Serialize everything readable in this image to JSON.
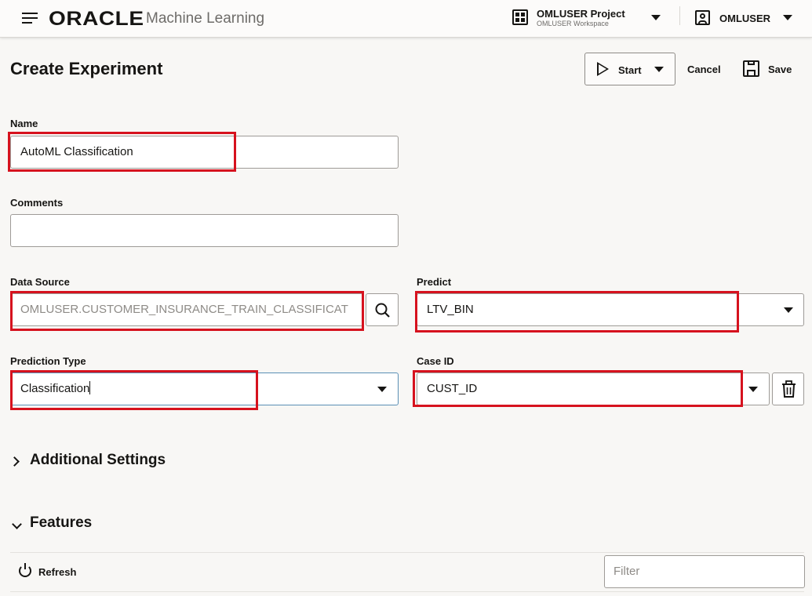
{
  "header": {
    "brand": "ORACLE",
    "app_name": "Machine Learning",
    "project_name": "OMLUSER Project",
    "workspace_name": "OMLUSER Workspace",
    "user_name": "OMLUSER"
  },
  "page": {
    "title": "Create Experiment",
    "start_label": "Start",
    "cancel_label": "Cancel",
    "save_label": "Save"
  },
  "form": {
    "name": {
      "label": "Name",
      "value": "AutoML Classification"
    },
    "comments": {
      "label": "Comments",
      "value": ""
    },
    "data_source": {
      "label": "Data Source",
      "value": "OMLUSER.CUSTOMER_INSURANCE_TRAIN_CLASSIFICAT"
    },
    "predict": {
      "label": "Predict",
      "value": "LTV_BIN"
    },
    "prediction_type": {
      "label": "Prediction Type",
      "value": "Classification"
    },
    "case_id": {
      "label": "Case ID",
      "value": "CUST_ID"
    }
  },
  "sections": {
    "additional_settings": "Additional Settings",
    "features": "Features"
  },
  "features_toolbar": {
    "refresh_label": "Refresh",
    "filter_placeholder": "Filter"
  },
  "colors": {
    "highlight": "#d6121e",
    "background": "#f8f7f5",
    "focus_border": "#5a8fb5"
  }
}
